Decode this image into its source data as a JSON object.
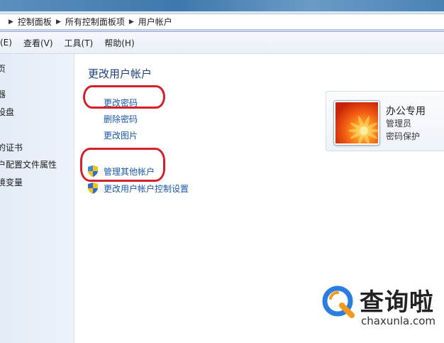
{
  "address_bar": {
    "breadcrumbs": [
      "控制面板",
      "所有控制面板项",
      "用户帐户"
    ]
  },
  "menu": {
    "items": [
      "(E)",
      "查看(V)",
      "工具(T)",
      "帮助(H)"
    ]
  },
  "left_nav": {
    "items": [
      "页",
      "器",
      "设盘",
      "的证书",
      "户配置文件属性",
      "境变量"
    ]
  },
  "main": {
    "heading": "更改用户帐户",
    "links": {
      "change_password": "更改密码",
      "remove_password": "删除密码",
      "change_picture": "更改图片",
      "manage_other_accounts": "管理其他帐户",
      "change_uac_settings": "更改用户帐户控制设置"
    }
  },
  "account": {
    "name": "办公专用",
    "role": "管理员",
    "password_status": "密码保护"
  },
  "annotations": {
    "highlight_color": "#d4202a"
  },
  "watermark": {
    "title": "查询啦",
    "url": "chaxunla.com"
  },
  "colors": {
    "link": "#1a57a8",
    "heading": "#1e3f7a",
    "watermark_blue": "#2b7de0",
    "watermark_orange": "#f39a1e"
  }
}
